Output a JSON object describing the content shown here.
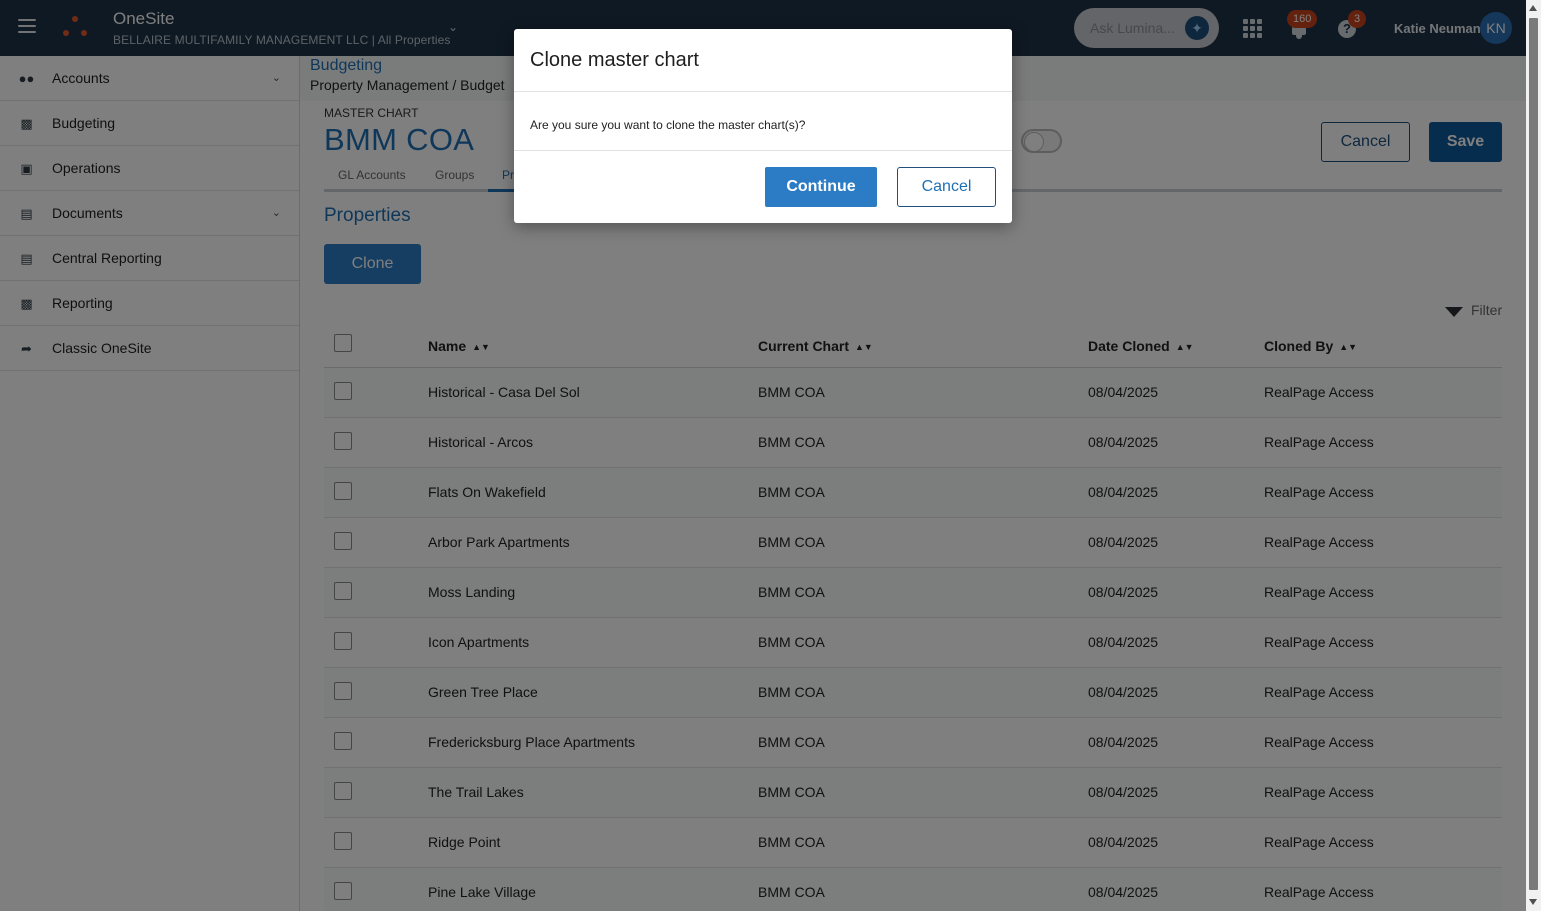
{
  "topbar": {
    "app_title": "OneSite",
    "company": "BELLAIRE MULTIFAMILY MANAGEMENT LLC | All Properties",
    "ask_placeholder": "Ask Lumina...",
    "notifications_count": "160",
    "help_count": "3",
    "user_name": "Katie Neuman",
    "user_initials": "KN",
    "icons": {
      "menu": "hamburger-menu-icon",
      "logo": "onesite-logo",
      "assistant": "lumina-orb-icon",
      "apps": "apps-grid-icon",
      "notifications": "bell-icon",
      "help": "help-icon"
    },
    "colors": {
      "background": "#1f3346",
      "badge": "#c8431a",
      "avatar": "#2a6fb5"
    }
  },
  "sidebar": {
    "items": [
      {
        "label": "Accounts",
        "icon": "users-icon",
        "has_chevron": true
      },
      {
        "label": "Budgeting",
        "icon": "bar-chart-icon",
        "has_chevron": false
      },
      {
        "label": "Operations",
        "icon": "briefcase-icon",
        "has_chevron": false
      },
      {
        "label": "Documents",
        "icon": "documents-icon",
        "has_chevron": true
      },
      {
        "label": "Central Reporting",
        "icon": "report-icon",
        "has_chevron": false
      },
      {
        "label": "Reporting",
        "icon": "report-chart-icon",
        "has_chevron": false
      },
      {
        "label": "Classic OneSite",
        "icon": "classic-icon",
        "has_chevron": false
      }
    ]
  },
  "breadcrumb": {
    "section": "Budgeting",
    "path": "Property Management  /  Budget"
  },
  "header": {
    "label": "MASTER CHART",
    "title": "BMM COA",
    "cancel_label": "Cancel",
    "save_label": "Save"
  },
  "tabs": [
    "GL Accounts",
    "Groups",
    "Pr"
  ],
  "properties": {
    "title": "Properties",
    "clone_label": "Clone",
    "filter_label": "Filter"
  },
  "table": {
    "columns": [
      "Name",
      "Current Chart",
      "Date Cloned",
      "Cloned By"
    ],
    "rows": [
      [
        "Historical - Casa Del Sol",
        "BMM COA",
        "08/04/2025",
        "RealPage Access"
      ],
      [
        "Historical - Arcos",
        "BMM COA",
        "08/04/2025",
        "RealPage Access"
      ],
      [
        "Flats On Wakefield",
        "BMM COA",
        "08/04/2025",
        "RealPage Access"
      ],
      [
        "Arbor Park Apartments",
        "BMM COA",
        "08/04/2025",
        "RealPage Access"
      ],
      [
        "Moss Landing",
        "BMM COA",
        "08/04/2025",
        "RealPage Access"
      ],
      [
        "Icon Apartments",
        "BMM COA",
        "08/04/2025",
        "RealPage Access"
      ],
      [
        "Green Tree Place",
        "BMM COA",
        "08/04/2025",
        "RealPage Access"
      ],
      [
        "Fredericksburg Place Apartments",
        "BMM COA",
        "08/04/2025",
        "RealPage Access"
      ],
      [
        "The Trail Lakes",
        "BMM COA",
        "08/04/2025",
        "RealPage Access"
      ],
      [
        "Ridge Point",
        "BMM COA",
        "08/04/2025",
        "RealPage Access"
      ],
      [
        "Pine Lake Village",
        "BMM COA",
        "08/04/2025",
        "RealPage Access"
      ]
    ]
  },
  "modal": {
    "title": "Clone master chart",
    "message": "Are you sure you want to clone the master chart(s)?",
    "continue_label": "Continue",
    "cancel_label": "Cancel"
  }
}
